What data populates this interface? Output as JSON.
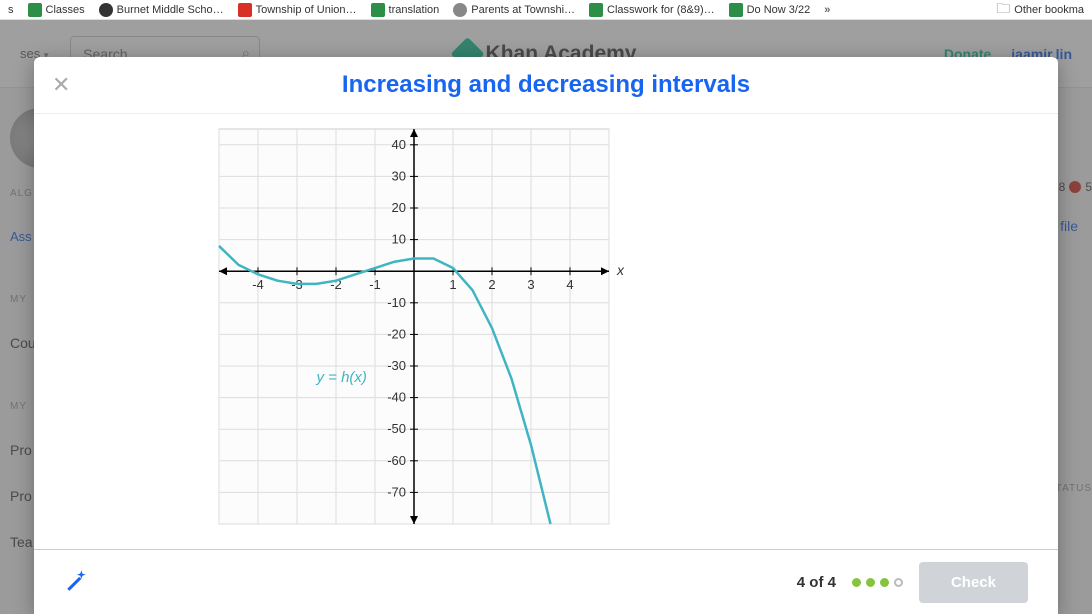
{
  "bookmarks": [
    {
      "label": "s",
      "icon": "none"
    },
    {
      "label": "Classes",
      "icon": "green"
    },
    {
      "label": "Burnet Middle Scho…",
      "icon": "dark"
    },
    {
      "label": "Township of Union…",
      "icon": "red"
    },
    {
      "label": "translation",
      "icon": "green"
    },
    {
      "label": "Parents at Townshi…",
      "icon": "gray"
    },
    {
      "label": "Classwork for (8&9)…",
      "icon": "green"
    },
    {
      "label": "Do Now 3/22",
      "icon": "green"
    }
  ],
  "other_bookmarks": "Other bookma",
  "header": {
    "courses": "ses",
    "search_placeholder": "Search",
    "brand": "Khan Academy",
    "donate": "Donate",
    "user": "iaamir.lin"
  },
  "background": {
    "alg": "ALG",
    "ass": "Ass",
    "my1": "MY",
    "cou": "Cou",
    "my2": "MY",
    "pro1": "Pro",
    "pro2": "Pro",
    "tea": "Tea",
    "badge": "8",
    "badge2": "5",
    "profile": "file",
    "status": "TATUS"
  },
  "modal": {
    "title": "Increasing and decreasing intervals",
    "progress": "4 of 4",
    "check": "Check"
  },
  "chart_data": {
    "type": "line",
    "function_label": "y = h(x)",
    "axis_label": "x",
    "x_ticks": [
      -4,
      -3,
      -2,
      -1,
      1,
      2,
      3,
      4
    ],
    "y_ticks": [
      40,
      30,
      20,
      10,
      -10,
      -20,
      -30,
      -40,
      -50,
      -60,
      -70
    ],
    "xlim": [
      -5,
      5
    ],
    "ylim": [
      -80,
      45
    ],
    "series": [
      {
        "name": "h(x)",
        "x": [
          -5,
          -4.5,
          -4,
          -3.5,
          -3,
          -2.5,
          -2,
          -1.5,
          -1,
          -0.5,
          0,
          0.5,
          1,
          1.5,
          2,
          2.5,
          3,
          3.5
        ],
        "y": [
          8,
          2,
          -1,
          -3,
          -4,
          -4,
          -3,
          -1,
          1,
          3,
          4,
          4,
          1,
          -6,
          -18,
          -34,
          -55,
          -80
        ]
      }
    ]
  }
}
